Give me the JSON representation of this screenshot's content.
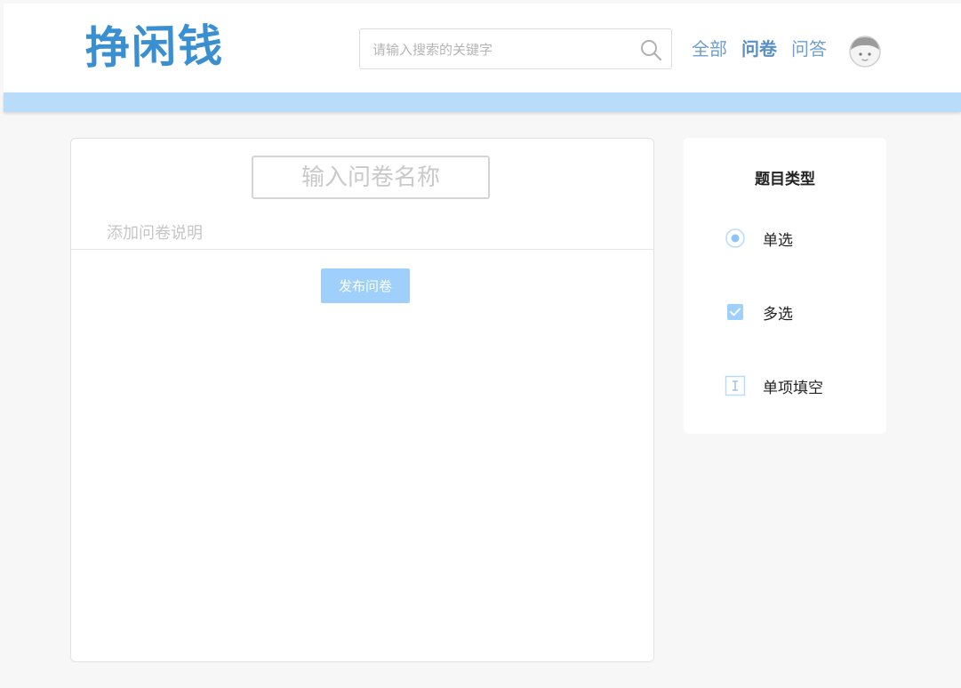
{
  "header": {
    "logo_text": "挣闲钱",
    "search": {
      "placeholder": "请输入搜索的关键字",
      "value": ""
    },
    "nav": [
      {
        "label": "全部",
        "active": false
      },
      {
        "label": "问卷",
        "active": true
      },
      {
        "label": "问答",
        "active": false
      }
    ],
    "avatar_icon": "user-avatar-icon",
    "accent_color": "#6f9fcd",
    "strip_color": "#b9dcfa"
  },
  "editor": {
    "title_placeholder": "输入问卷名称",
    "description_placeholder": "添加问卷说明",
    "publish_label": "发布问卷",
    "publish_color": "#9ed0fb"
  },
  "panel": {
    "title": "题目类型",
    "types": [
      {
        "label": "单选",
        "icon": "radio-icon"
      },
      {
        "label": "多选",
        "icon": "checkbox-icon"
      },
      {
        "label": "单项填空",
        "icon": "text-input-icon"
      }
    ]
  }
}
